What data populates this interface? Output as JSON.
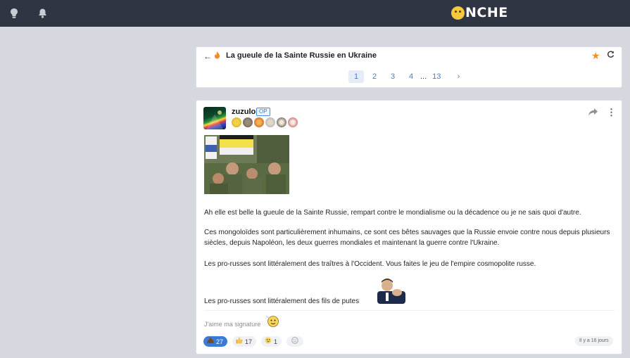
{
  "header": {
    "logo_text": "NCHE",
    "icons": [
      "lightbulb-icon",
      "bell-icon"
    ]
  },
  "topic": {
    "title": "La gueule de la Sainte Russie en Ukraine",
    "pagination": {
      "pages": [
        "1",
        "2",
        "3",
        "4"
      ],
      "ellipsis": "...",
      "last": "13",
      "current": "1"
    }
  },
  "post": {
    "author": "zuzulo",
    "op_label": "OP",
    "paragraphs": [
      "Ah elle est belle la gueule de la Sainte Russie, rempart contre le mondialisme ou la décadence ou je ne sais quoi d'autre.",
      "Ces mongoloïdes sont particulièrement inhumains, ce sont ces bêtes sauvages que la Russie envoie contre nous depuis plusieurs siècles, depuis Napoléon, les deux guerres mondiales et maintenant la guerre contre l'Ukraine.",
      "Les pro-russes sont littéralement des traîtres à l'Occident. Vous faites le jeu de l'empire cosmopolite russe.",
      "Les pro-russes sont littéralement des fils de putes"
    ],
    "signature": "J'aime ma signature",
    "reactions": [
      {
        "icon": "poop-icon",
        "count": "27"
      },
      {
        "icon": "thumbs-up-icon",
        "count": "17"
      },
      {
        "icon": "thinking-icon",
        "count": "1"
      },
      {
        "icon": "add-reaction-icon",
        "count": ""
      }
    ],
    "timestamp": "Il y a 16 jours"
  },
  "colors": {
    "header_bg": "#2f3542",
    "page_bg": "#d5d8df",
    "accent": "#3a7bd5",
    "star": "#f3902c"
  }
}
